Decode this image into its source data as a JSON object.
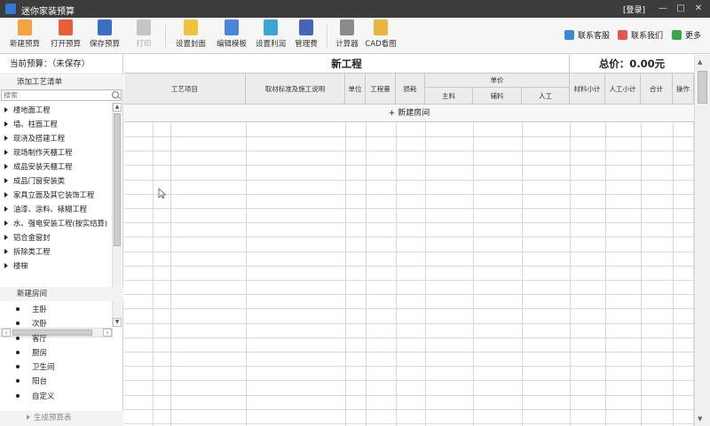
{
  "window": {
    "title": "迷你家装预算",
    "login": "[登录]"
  },
  "toolbar": {
    "buttons": [
      {
        "label": "新建预算",
        "icon": "new-budget-icon",
        "color": "#f4a340"
      },
      {
        "label": "打开预算",
        "icon": "open-budget-icon",
        "color": "#e85d3a"
      },
      {
        "label": "保存预算",
        "icon": "save-budget-icon",
        "color": "#3a6fc4"
      },
      {
        "label": "打印",
        "icon": "print-icon",
        "color": "#b5b5b5"
      },
      {
        "label": "设置封面",
        "icon": "cover-settings-icon",
        "color": "#f0c33c"
      },
      {
        "label": "编辑模板",
        "icon": "edit-template-icon",
        "color": "#4a86d8"
      },
      {
        "label": "设置利润",
        "icon": "profit-settings-icon",
        "color": "#3aa6d6"
      },
      {
        "label": "管理费",
        "icon": "management-fee-icon",
        "color": "#4566b8"
      },
      {
        "label": "计算器",
        "icon": "calculator-icon",
        "color": "#8a8a8a"
      },
      {
        "label": "CAD看图",
        "icon": "cad-viewer-icon",
        "color": "#e8b63a"
      }
    ],
    "right_links": [
      {
        "label": "联系客服",
        "icon": "customer-service-icon",
        "color": "#3a88d6"
      },
      {
        "label": "联系我们",
        "icon": "contact-us-icon",
        "color": "#e05a4a"
      },
      {
        "label": "更多",
        "icon": "more-icon",
        "color": "#3aa64a"
      }
    ]
  },
  "sidebar": {
    "current_budget": "当前预算：（未保存）",
    "add_section_title": "添加工艺清单",
    "search_placeholder": "搜索",
    "categories": [
      "楼地面工程",
      "墙、柱面工程",
      "现浇及搭建工程",
      "现场制作天棚工程",
      "成品安装天棚工程",
      "成品门窗安装类",
      "家具立面及其它装饰工程",
      "油漆、涂料、裱糊工程",
      "水、强电安装工程(按实结算)",
      "铝合金窗封",
      "拆除类工程",
      "楼梯"
    ],
    "new_room_title": "新建房间",
    "rooms": [
      "主卧",
      "次卧",
      "客厅",
      "厨房",
      "卫生间",
      "阳台",
      "自定义"
    ],
    "generate_table": "生成预算表"
  },
  "main": {
    "project_title": "新工程",
    "total_label": "总价：0.00元",
    "headers": {
      "process": "工艺项目",
      "material_std": "取材标准及施工说明",
      "unit": "单位",
      "quantity": "工程量",
      "loss": "损耗",
      "unit_price": "单价",
      "main_material": "主料",
      "aux_material": "辅料",
      "labor": "人工",
      "material_subtotal": "材料小计",
      "labor_subtotal": "人工小计",
      "total": "合计",
      "operation": "操作"
    },
    "add_room": "+ 新建房间"
  }
}
